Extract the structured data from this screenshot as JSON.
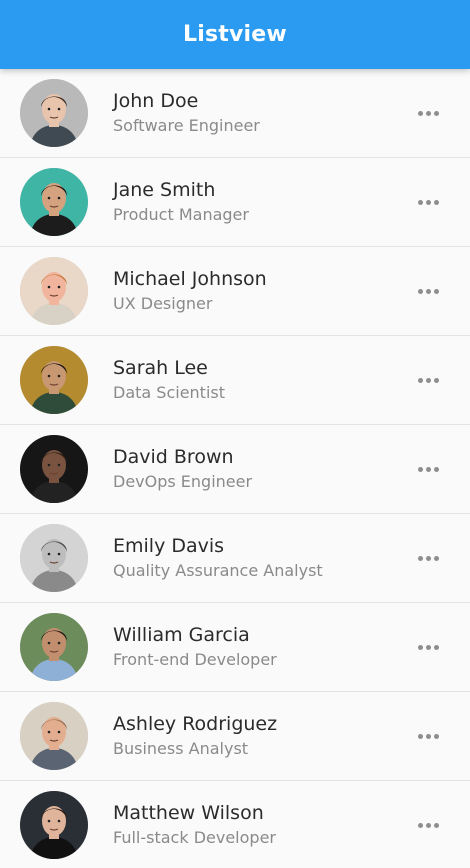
{
  "appbar": {
    "title": "Listview",
    "color": "#2a9bf0"
  },
  "list": {
    "items": [
      {
        "name": "John Doe",
        "role": "Software Engineer",
        "avatar_bg": "#b9b9b9",
        "skin": "#e8c4ad",
        "hair": "#3a2a22",
        "shirt": "#3f4a52"
      },
      {
        "name": "Jane Smith",
        "role": "Product Manager",
        "avatar_bg": "#3fb5a6",
        "skin": "#d4a27e",
        "hair": "#1d1410",
        "shirt": "#1c1c1c"
      },
      {
        "name": "Michael Johnson",
        "role": "UX Designer",
        "avatar_bg": "#e9d7c8",
        "skin": "#f0b59c",
        "hair": "#c77a3e",
        "shirt": "#d8d1c6"
      },
      {
        "name": "Sarah Lee",
        "role": "Data Scientist",
        "avatar_bg": "#b58b2f",
        "skin": "#c79872",
        "hair": "#1a1410",
        "shirt": "#2f4b39"
      },
      {
        "name": "David Brown",
        "role": "DevOps Engineer",
        "avatar_bg": "#161616",
        "skin": "#7a5340",
        "hair": "#2a1d16",
        "shirt": "#222222"
      },
      {
        "name": "Emily Davis",
        "role": "Quality Assurance Analyst",
        "avatar_bg": "#d4d4d4",
        "skin": "#bdbdbd",
        "hair": "#4a4a4a",
        "shirt": "#8a8a8a"
      },
      {
        "name": "William Garcia",
        "role": "Front-end Developer",
        "avatar_bg": "#6d8c5b",
        "skin": "#c28f6e",
        "hair": "#1e1612",
        "shirt": "#8fb0d6"
      },
      {
        "name": "Ashley Rodriguez",
        "role": "Business Analyst",
        "avatar_bg": "#d9d0c4",
        "skin": "#e2ae8f",
        "hair": "#9a7258",
        "shirt": "#5a6472"
      },
      {
        "name": "Matthew Wilson",
        "role": "Full-stack Developer",
        "avatar_bg": "#2a2f36",
        "skin": "#e0b49a",
        "hair": "#2a1c14",
        "shirt": "#111111"
      }
    ],
    "more_icon": "more-horizontal-icon"
  }
}
